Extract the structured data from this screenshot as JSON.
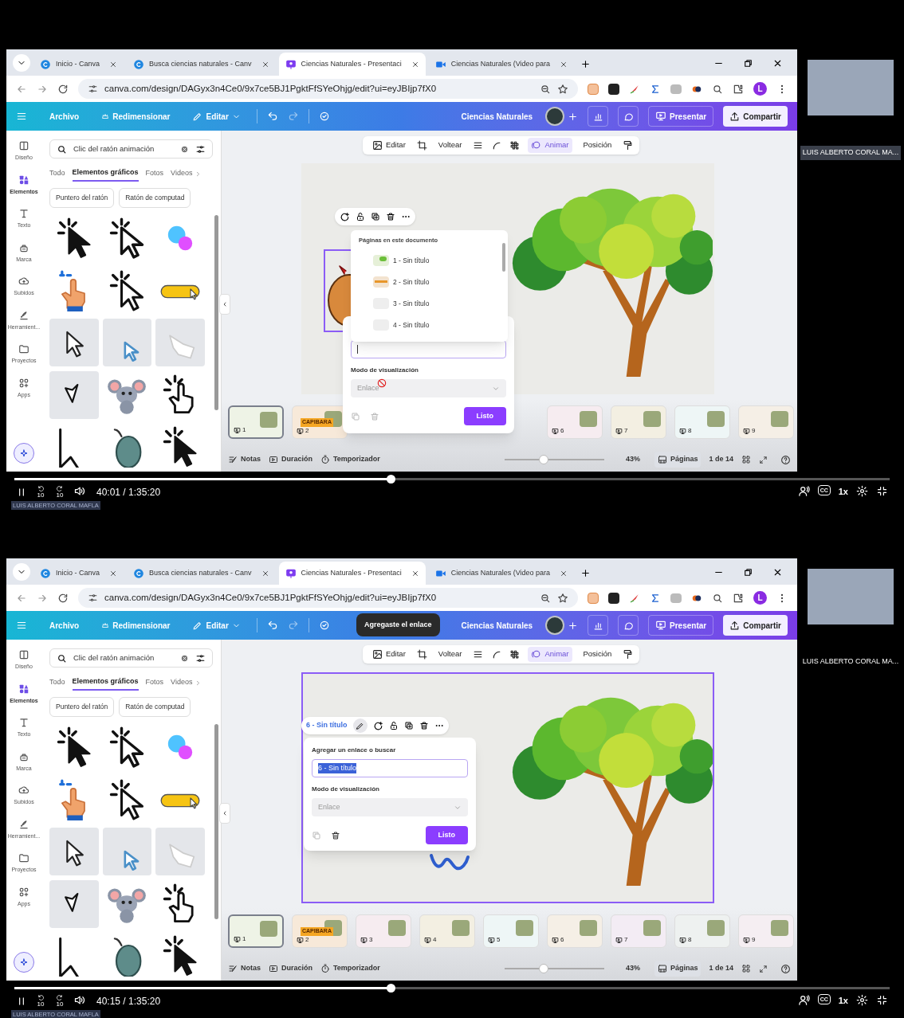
{
  "frames": [
    {
      "browser_tabs": [
        {
          "label": "Inicio - Canva",
          "selected": false
        },
        {
          "label": "Busca ciencias naturales - Canv",
          "selected": false
        },
        {
          "label": "Ciencias Naturales - Presentaci",
          "selected": true
        },
        {
          "label": "Ciencias Naturales (Video para",
          "selected": false
        }
      ],
      "url": "canva.com/design/DAGyx3n4Ce0/9x7ce5BJ1PgktFfSYeOhjg/edit?ui=eyJBIjp7fX0",
      "profile_initial": "L",
      "menu": [
        "Archivo",
        "Redimensionar",
        "Editar"
      ],
      "doc_title": "Ciencias Naturales",
      "present": "Presentar",
      "share": "Compartir",
      "rail": [
        {
          "label": "Diseño",
          "selected": false
        },
        {
          "label": "Elementos",
          "selected": true
        },
        {
          "label": "Texto",
          "selected": false
        },
        {
          "label": "Marca",
          "selected": false
        },
        {
          "label": "Subidos",
          "selected": false
        },
        {
          "label": "Herramient...",
          "selected": false
        },
        {
          "label": "Proyectos",
          "selected": false
        },
        {
          "label": "Apps",
          "selected": false
        }
      ],
      "search": {
        "value": "Clic del ratón animación"
      },
      "filters": [
        {
          "label": "Todo",
          "selected": false
        },
        {
          "label": "Elementos gráficos",
          "selected": true
        },
        {
          "label": "Fotos",
          "selected": false
        },
        {
          "label": "Videos",
          "selected": false
        }
      ],
      "chips": [
        "Puntero del ratón",
        "Ratón de computad"
      ],
      "element_toolbar": [
        {
          "kind": "button",
          "label": "Editar",
          "selected": false
        },
        {
          "kind": "icon",
          "selected": false
        },
        {
          "kind": "button",
          "label": "Voltear",
          "selected": false
        },
        {
          "kind": "icon",
          "selected": false
        },
        {
          "kind": "icon",
          "selected": false
        },
        {
          "kind": "icon",
          "selected": false
        },
        {
          "kind": "button",
          "label": "Animar",
          "selected": true
        },
        {
          "kind": "button",
          "label": "Posición",
          "selected": false
        },
        {
          "kind": "icon",
          "selected": false
        }
      ],
      "canvas": {
        "selected": false,
        "elements": [
          {
            "kind": "sack",
            "selected": true
          },
          {
            "kind": "tree",
            "selected": false
          }
        ]
      },
      "page_menu": {
        "title": "Páginas en este documento",
        "items": [
          "1 - Sin título",
          "2 - Sin título",
          "3 - Sin título",
          "4 - Sin título"
        ]
      },
      "link_panel": {
        "mode_label": "Modo de visualización",
        "mode_value": "Enlace",
        "done": "Listo",
        "cursor_blocked": true
      },
      "thumbnails": [
        {
          "number": "1",
          "selected": true
        },
        {
          "number": "2",
          "title": "CAPIBARA",
          "selected": false
        },
        {
          "number": "6",
          "selected": false
        },
        {
          "number": "7",
          "selected": false
        },
        {
          "number": "8",
          "selected": false
        },
        {
          "number": "9",
          "selected": false
        }
      ],
      "footer": {
        "notes": "Notas",
        "duration": "Duración",
        "timer": "Temporizador",
        "zoom": {
          "level": 0.4
        },
        "zoom_reading": "43%",
        "pages": "Páginas",
        "page_count": "1 de 14"
      },
      "participant": {
        "name": "LUIS ALBERTO CORAL MA...",
        "speaking": true
      },
      "player": {
        "level": 0.43,
        "time": "40:01 / 1:35:20",
        "skip_back": "10",
        "skip_forward": "10",
        "captions": "CC",
        "speed": "1x",
        "caption_name": "LUIS ALBERTO CORAL MAFLA"
      }
    },
    {
      "browser_tabs": [
        {
          "label": "Inicio - Canva",
          "selected": false
        },
        {
          "label": "Busca ciencias naturales - Canv",
          "selected": false
        },
        {
          "label": "Ciencias Naturales - Presentaci",
          "selected": true
        },
        {
          "label": "Ciencias Naturales (Video para",
          "selected": false
        }
      ],
      "url": "canva.com/design/DAGyx3n4Ce0/9x7ce5BJ1PgktFfSYeOhjg/edit?ui=eyJBIjp7fX0",
      "profile_initial": "L",
      "menu": [
        "Archivo",
        "Redimensionar",
        "Editar"
      ],
      "toast": "Agregaste el enlace",
      "doc_title": "Ciencias Naturales",
      "present": "Presentar",
      "share": "Compartir",
      "rail": [
        {
          "label": "Diseño",
          "selected": false
        },
        {
          "label": "Elementos",
          "selected": true
        },
        {
          "label": "Texto",
          "selected": false
        },
        {
          "label": "Marca",
          "selected": false
        },
        {
          "label": "Subidos",
          "selected": false
        },
        {
          "label": "Herramient...",
          "selected": false
        },
        {
          "label": "Proyectos",
          "selected": false
        },
        {
          "label": "Apps",
          "selected": false
        }
      ],
      "search": {
        "value": "Clic del ratón animación"
      },
      "filters": [
        {
          "label": "Todo",
          "selected": false
        },
        {
          "label": "Elementos gráficos",
          "selected": true
        },
        {
          "label": "Fotos",
          "selected": false
        },
        {
          "label": "Videos",
          "selected": false
        }
      ],
      "chips": [
        "Puntero del ratón",
        "Ratón de computad"
      ],
      "element_toolbar": [
        {
          "kind": "button",
          "label": "Editar",
          "selected": false
        },
        {
          "kind": "icon",
          "selected": false
        },
        {
          "kind": "button",
          "label": "Voltear",
          "selected": false
        },
        {
          "kind": "icon",
          "selected": false
        },
        {
          "kind": "icon",
          "selected": false
        },
        {
          "kind": "icon",
          "selected": false
        },
        {
          "kind": "button",
          "label": "Animar",
          "selected": true
        },
        {
          "kind": "button",
          "label": "Posición",
          "selected": false
        },
        {
          "kind": "icon",
          "selected": false
        }
      ],
      "canvas": {
        "selected": true,
        "elements": [
          {
            "kind": "tree",
            "selected": false
          },
          {
            "kind": "squiggle",
            "selected": false
          }
        ]
      },
      "object_toolbar": {
        "link_label": "6 - Sin título"
      },
      "link_panel": {
        "label": "Agregar un enlace o buscar",
        "value": "6 - Sin título",
        "value_selected": true,
        "mode_label": "Modo de visualización",
        "mode_value": "Enlace",
        "done": "Listo"
      },
      "thumbnails": [
        {
          "number": "1",
          "selected": true
        },
        {
          "number": "2",
          "title": "CAPIBARA",
          "selected": false
        },
        {
          "number": "3",
          "selected": false
        },
        {
          "number": "4",
          "selected": false
        },
        {
          "number": "5",
          "selected": false
        },
        {
          "number": "6",
          "selected": false
        },
        {
          "number": "7",
          "selected": false
        },
        {
          "number": "8",
          "selected": false
        },
        {
          "number": "9",
          "selected": false
        }
      ],
      "footer": {
        "notes": "Notas",
        "duration": "Duración",
        "timer": "Temporizador",
        "zoom": {
          "level": 0.4
        },
        "zoom_reading": "43%",
        "pages": "Páginas",
        "page_count": "1 de 14"
      },
      "participant": {
        "name": "LUIS ALBERTO CORAL MA...",
        "speaking": false
      },
      "player": {
        "level": 0.43,
        "time": "40:15 / 1:35:20",
        "skip_back": "10",
        "skip_forward": "10",
        "captions": "CC",
        "speed": "1x",
        "caption_name": "LUIS ALBERTO CORAL MAFLA"
      }
    }
  ]
}
